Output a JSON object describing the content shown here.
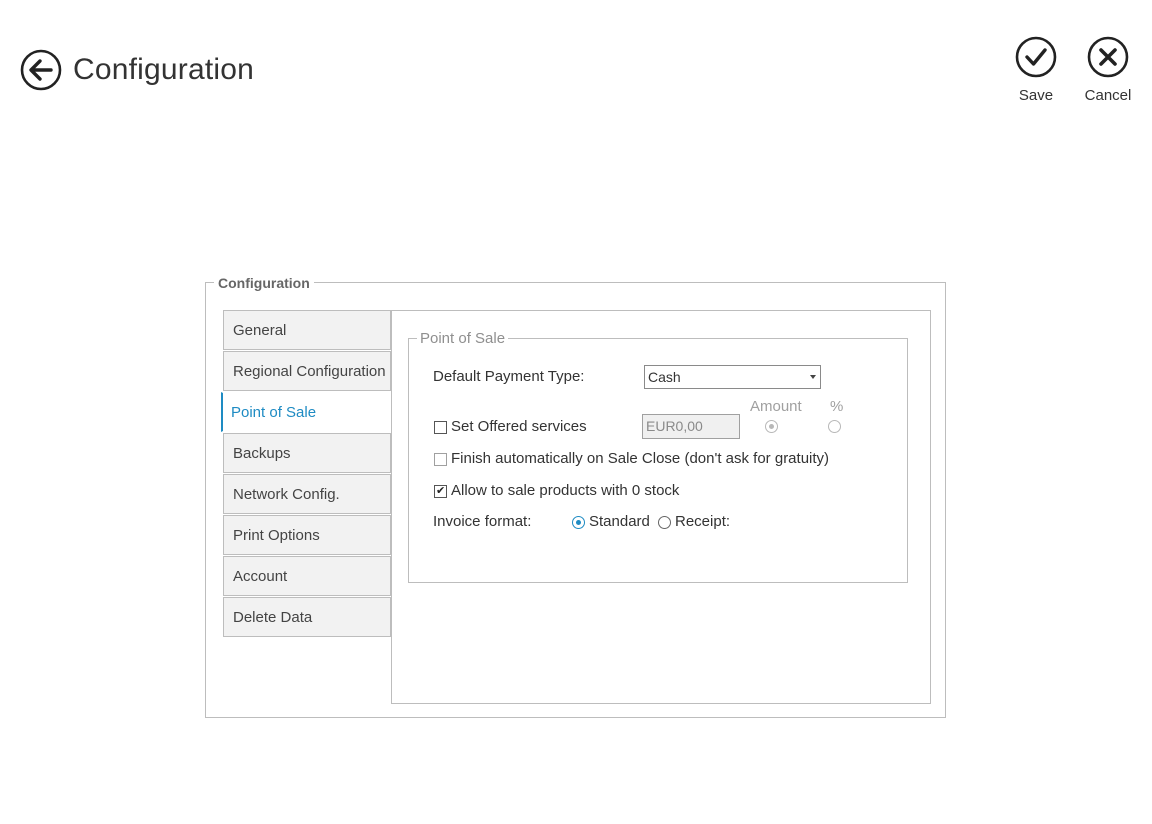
{
  "header": {
    "title": "Configuration",
    "back_icon": "arrow-left-circle-icon"
  },
  "commands": {
    "save_label": "Save",
    "cancel_label": "Cancel"
  },
  "config_group": {
    "legend": "Configuration",
    "tabs": [
      {
        "label": "General"
      },
      {
        "label": "Regional Configuration"
      },
      {
        "label": "Point of Sale",
        "active": true
      },
      {
        "label": "Backups"
      },
      {
        "label": "Network Config."
      },
      {
        "label": "Print Options"
      },
      {
        "label": "Account"
      },
      {
        "label": "Delete Data"
      }
    ]
  },
  "pos": {
    "legend": "Point of Sale",
    "default_payment_label": "Default Payment Type:",
    "default_payment_value": "Cash",
    "offered_services_label": "Set Offered services",
    "offered_services_checked": false,
    "amount_value": "EUR0,00",
    "amount_label": "Amount",
    "percent_label": "%",
    "finish_auto_label": "Finish automatically on Sale Close (don't ask for gratuity)",
    "finish_auto_checked": false,
    "allow_zero_stock_label": "Allow to sale products with 0 stock",
    "allow_zero_stock_checked": true,
    "invoice_format_label": "Invoice format:",
    "invoice_standard_label": "Standard",
    "invoice_receipt_label": "Receipt:",
    "invoice_selected": "Standard"
  },
  "colors": {
    "accent": "#1e8bc3",
    "border": "#bdbdbd",
    "tab_bg": "#f2f2f2"
  }
}
